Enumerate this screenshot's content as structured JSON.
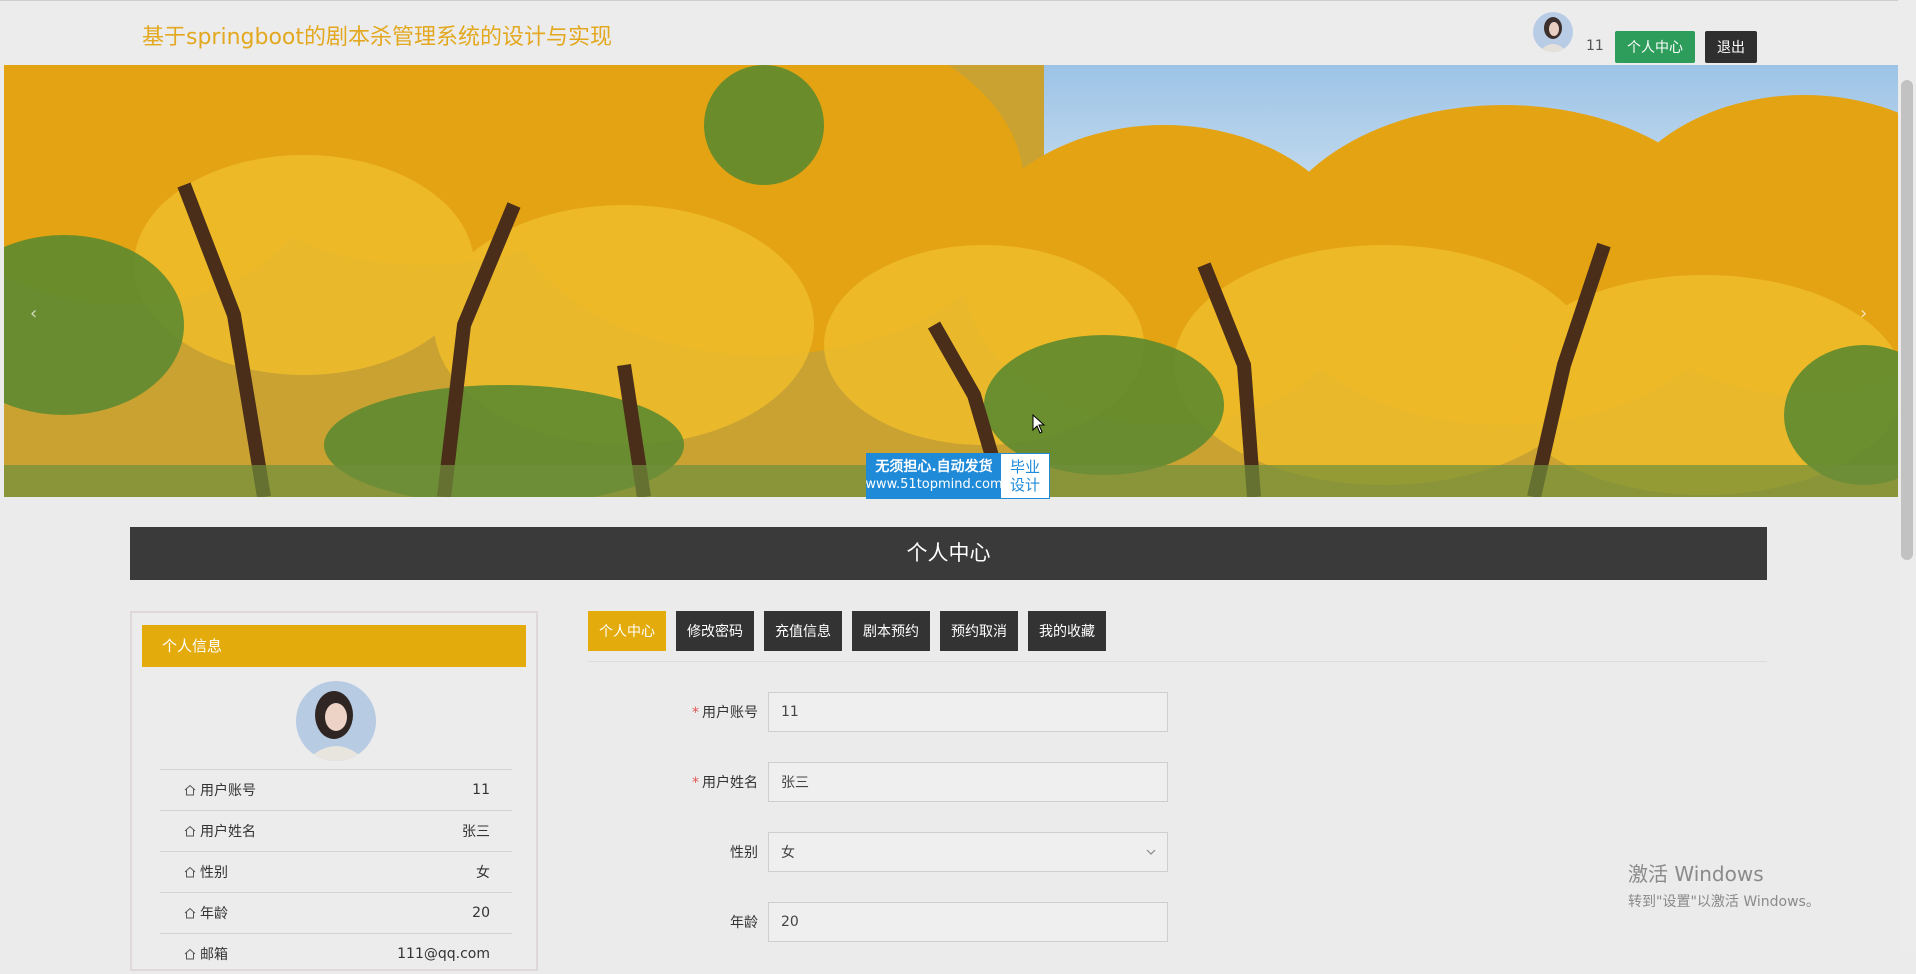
{
  "header": {
    "site_title": "基于springboot的剧本杀管理系统的设计与实现",
    "username": "11",
    "personal_center_button": "个人中心",
    "logout_button": "退出"
  },
  "banner": {
    "watermark_line1": "无须担心.自动发货",
    "watermark_line2": "www.51topmind.com",
    "watermark_right_line1": "毕业",
    "watermark_right_line2": "设计",
    "prev_icon": "chevron-left-icon",
    "next_icon": "chevron-right-icon"
  },
  "section": {
    "title": "个人中心"
  },
  "profile_card": {
    "header": "个人信息",
    "rows": [
      {
        "label": "用户账号",
        "value": "11"
      },
      {
        "label": "用户姓名",
        "value": "张三"
      },
      {
        "label": "性别",
        "value": "女"
      },
      {
        "label": "年龄",
        "value": "20"
      },
      {
        "label": "邮箱",
        "value": "111@qq.com"
      }
    ]
  },
  "tabs": [
    {
      "label": "个人中心",
      "active": true
    },
    {
      "label": "修改密码",
      "active": false
    },
    {
      "label": "充值信息",
      "active": false
    },
    {
      "label": "剧本预约",
      "active": false
    },
    {
      "label": "预约取消",
      "active": false
    },
    {
      "label": "我的收藏",
      "active": false
    }
  ],
  "form": {
    "required_mark": "*",
    "account": {
      "label": "用户账号",
      "value": "11"
    },
    "name": {
      "label": "用户姓名",
      "value": "张三"
    },
    "gender": {
      "label": "性别",
      "value": "女"
    },
    "age": {
      "label": "年龄",
      "value": "20"
    }
  },
  "windows_activation": {
    "title": "激活 Windows",
    "subtitle": "转到\"设置\"以激活 Windows。"
  },
  "colors": {
    "accent": "#e3ab0c",
    "title_color": "#e3a81f",
    "success_button": "#2e9c5a",
    "dark": "#333333"
  }
}
